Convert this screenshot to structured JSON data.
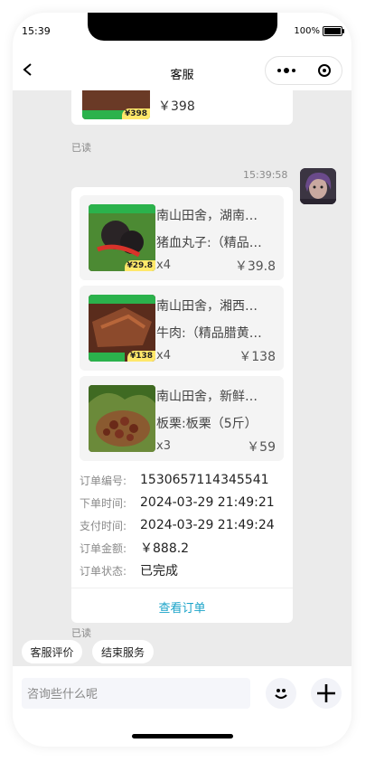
{
  "status": {
    "time": "15:39",
    "battery": "100%"
  },
  "nav": {
    "title": "客服"
  },
  "icons": {
    "back": "chevron-left-icon",
    "more": "more-dots-icon",
    "target": "record-target-icon",
    "emoji": "emoji-face-icon",
    "add": "plus-icon"
  },
  "prev_message": {
    "price": "￥398",
    "thumb_tag": "¥398",
    "read": "已读"
  },
  "order_message": {
    "timestamp": "15:39:58",
    "items": [
      {
        "title": "南山田舍，湖南…",
        "spec": "猪血丸子:（精品…",
        "qty": "x4",
        "price": "￥39.8",
        "tag": "¥29.8"
      },
      {
        "title": "南山田舍，湘西…",
        "spec": "牛肉:（精品腊黄…",
        "qty": "x4",
        "price": "￥138",
        "tag": "¥138"
      },
      {
        "title": "南山田舍，新鲜…",
        "spec": "板栗:板栗（5斤）",
        "qty": "x3",
        "price": "￥59"
      }
    ],
    "details": [
      {
        "label": "订单编号:",
        "value": "1530657114345541"
      },
      {
        "label": "下单时间:",
        "value": "2024-03-29 21:49:21"
      },
      {
        "label": "支付时间:",
        "value": "2024-03-29 21:49:24"
      },
      {
        "label": "订单金额:",
        "value": "￥888.2"
      },
      {
        "label": "订单状态:",
        "value": "已完成"
      }
    ],
    "view_order": "查看订单",
    "read": "已读"
  },
  "quick_actions": [
    {
      "label": "客服评价"
    },
    {
      "label": "结束服务"
    }
  ],
  "input": {
    "placeholder": "咨询些什么呢",
    "value": ""
  },
  "colors": {
    "chat_bg": "#ebebeb",
    "link": "#1aa3c8",
    "price_tag": "#ffe86a",
    "brand_green": "#2bb24c"
  }
}
